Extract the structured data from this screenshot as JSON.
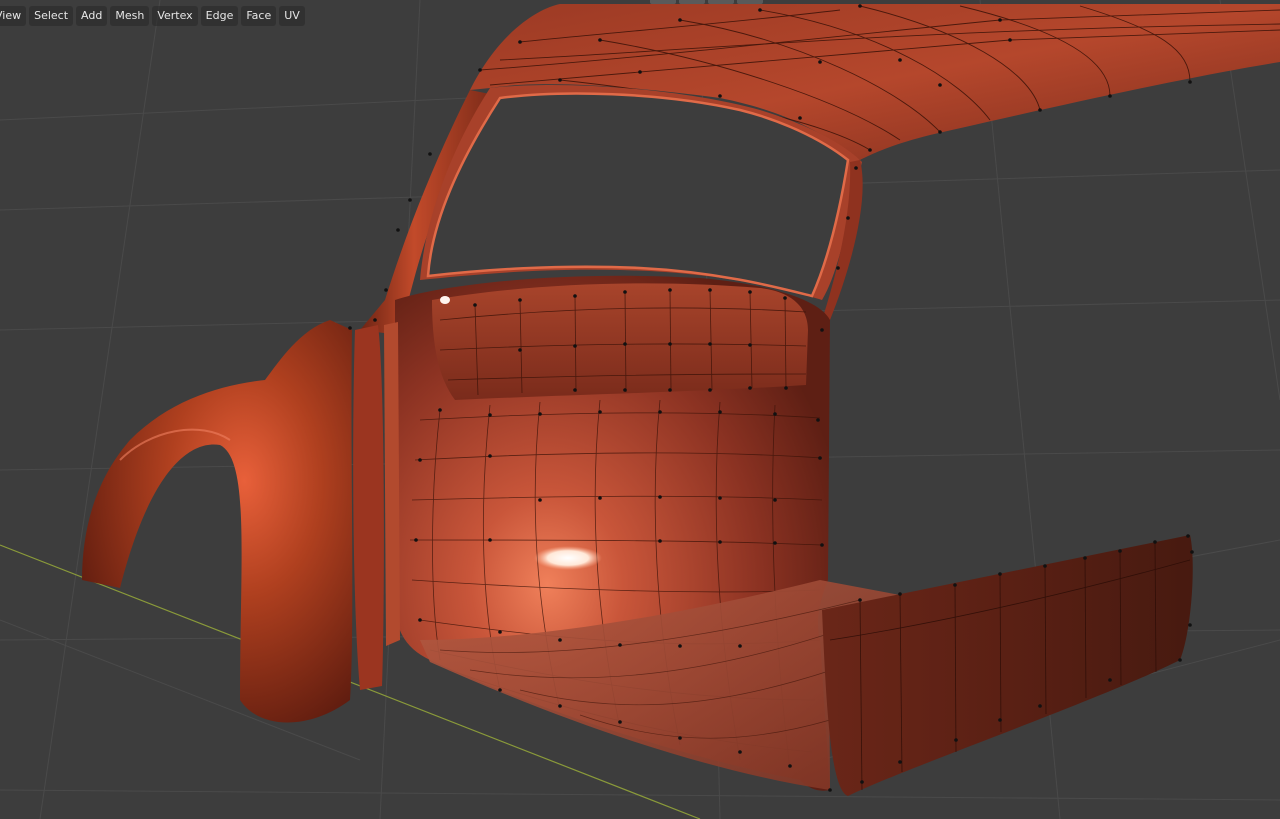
{
  "viewport": {
    "menu": [
      {
        "label": "View"
      },
      {
        "label": "Select"
      },
      {
        "label": "Add"
      },
      {
        "label": "Mesh"
      },
      {
        "label": "Vertex"
      },
      {
        "label": "Edge"
      },
      {
        "label": "Face"
      },
      {
        "label": "UV"
      }
    ],
    "mode": "Edit Mode",
    "object_color": "#b5432a",
    "background_color": "#3d3d3d",
    "grid_color": "#4a4a4a",
    "x_axis_color": "#8a9a3a"
  }
}
